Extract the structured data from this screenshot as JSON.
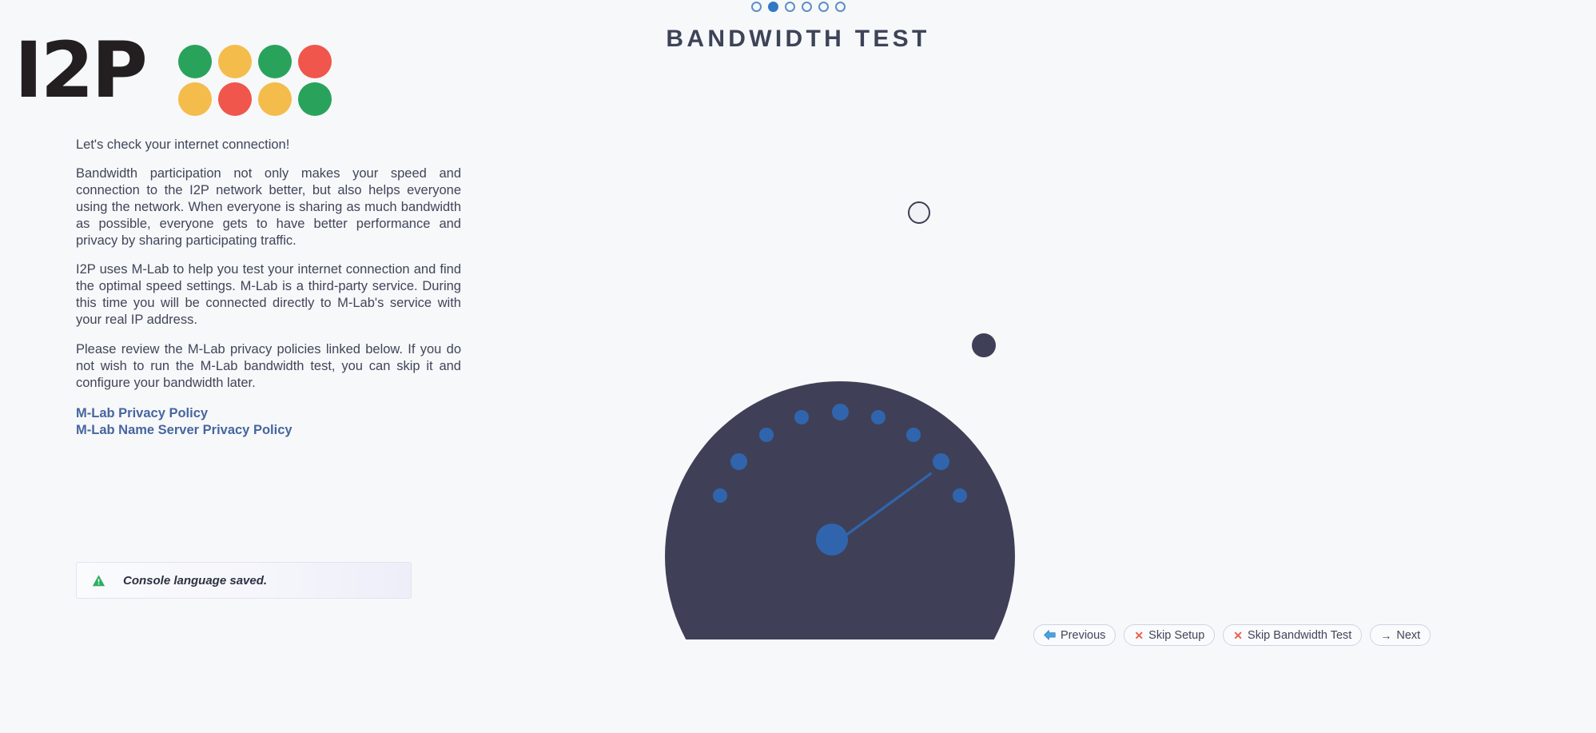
{
  "logo": {
    "wordmark": "I2P",
    "dot_colors": [
      "#29a35b",
      "#f4bc4b",
      "#29a35b",
      "#f0564b",
      "#f4bc4b",
      "#f0564b",
      "#f4bc4b",
      "#29a35b"
    ]
  },
  "header": {
    "title": "BANDWIDTH TEST",
    "steps": {
      "total": 6,
      "active_index": 1
    },
    "active_color": "#3178c6",
    "inactive_border": "#5d8ec9"
  },
  "intro": {
    "lead": "Let's check your internet connection!",
    "paragraph_1": "Bandwidth participation not only makes your speed and connection to the I2P network better, but also helps everyone using the network. When everyone is sharing as much bandwidth as possible, everyone gets to have better performance and privacy by sharing participating traffic.",
    "paragraph_2": "I2P uses M-Lab to help you test your internet connection and find the optimal speed settings. M-Lab is a third-party service. During this time you will be connected directly to M-Lab's service with your real IP address.",
    "paragraph_3": "Please review the M-Lab privacy policies linked below. If you do not wish to run the M-Lab bandwidth test, you can skip it and configure your bandwidth later."
  },
  "links": [
    {
      "label": "M-Lab Privacy Policy"
    },
    {
      "label": "M-Lab Name Server Privacy Policy"
    }
  ],
  "notification": {
    "message": "Console language saved.",
    "icon": "warning-triangle-icon",
    "icon_color": "#2eae63"
  },
  "gauge": {
    "body_color": "#3f4057",
    "tick_color": "#3065ad",
    "needle_color": "#3065ad",
    "needle_angle_deg": -36,
    "tick_count": 9,
    "loader_ring_color": "#3d4054",
    "loader_ball_color": "#3f4057"
  },
  "buttons": [
    {
      "label": "Previous",
      "icon": "arrow-left-icon",
      "icon_kind": "blue-left-arrow"
    },
    {
      "label": "Skip Setup",
      "icon": "close-x-icon",
      "icon_kind": "red-x"
    },
    {
      "label": "Skip Bandwidth Test",
      "icon": "close-x-icon",
      "icon_kind": "red-x"
    },
    {
      "label": "Next",
      "icon": "arrow-right-icon",
      "icon_kind": "arrow-right"
    }
  ]
}
